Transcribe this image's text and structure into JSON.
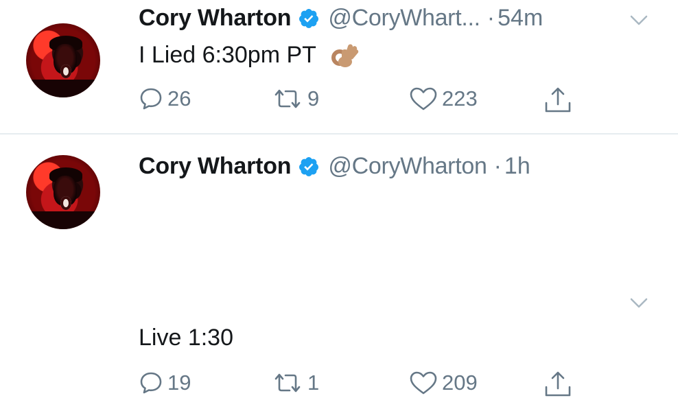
{
  "tweets": [
    {
      "display_name": "Cory Wharton",
      "handle": "@CoryWhart...",
      "separator": "·",
      "time": "54m",
      "text": "I Lied 6:30pm PT",
      "emoji_icon": "ok-hand-emoji-icon",
      "replies": "26",
      "retweets": "9",
      "likes": "223"
    },
    {
      "display_name": "Cory Wharton",
      "handle": "@CoryWharton",
      "separator": "·",
      "time": "1h",
      "text": "Live 1:30",
      "replies": "19",
      "retweets": "1",
      "likes": "209"
    }
  ],
  "colors": {
    "text": "#14171a",
    "secondary": "#657786",
    "verified_blue": "#1da1f2",
    "divider": "#e6ecf0"
  },
  "icons": [
    "verified-badge-icon",
    "chevron-down-icon",
    "reply-icon",
    "retweet-icon",
    "like-icon",
    "share-icon"
  ]
}
